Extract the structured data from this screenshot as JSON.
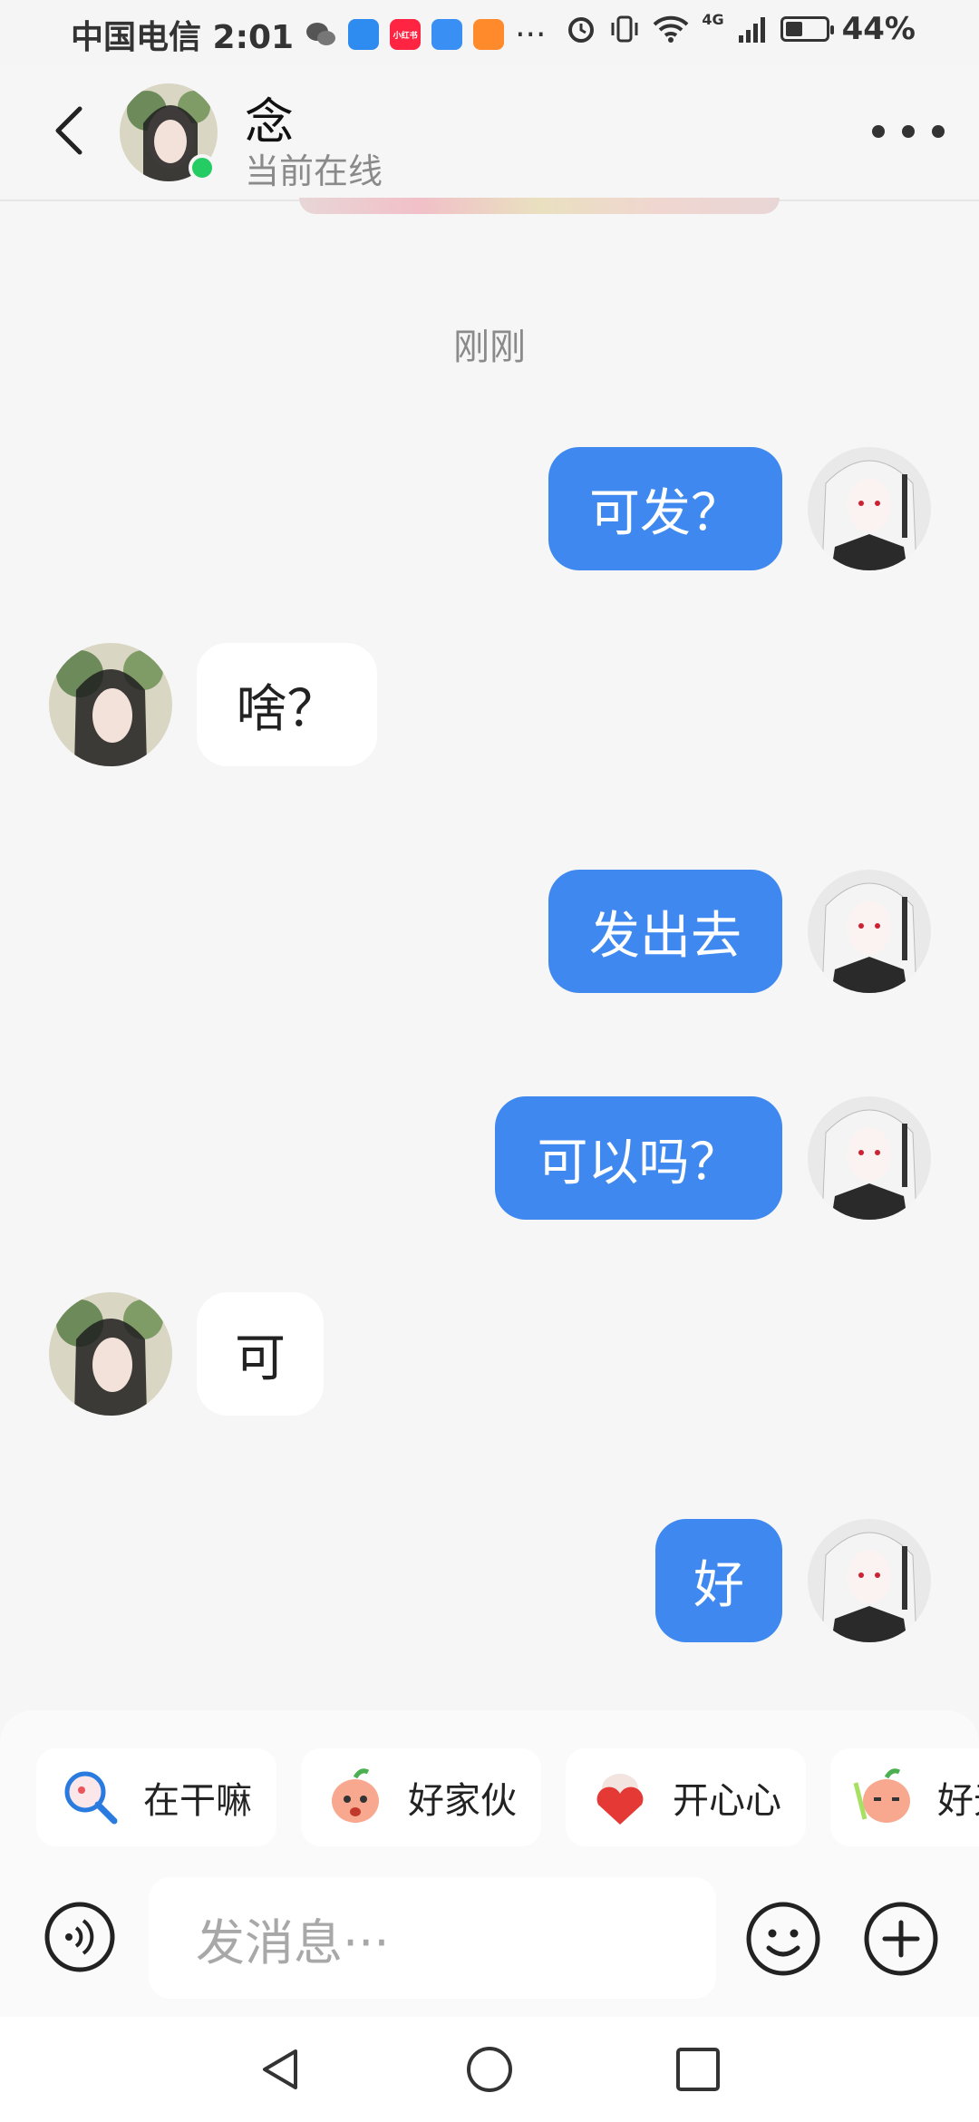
{
  "status_bar": {
    "carrier_time": "中国电信 2:01",
    "extra": "···",
    "app_badge_text": "小红书",
    "network": "4G",
    "battery": "44%",
    "battery_level": 0.44
  },
  "header": {
    "contact_name": "念",
    "status": "当前在线"
  },
  "time_divider": "刚刚",
  "messages": [
    {
      "side": "out",
      "text": "可发？"
    },
    {
      "side": "in",
      "text": "啥？"
    },
    {
      "side": "out",
      "text": "发出去"
    },
    {
      "side": "out",
      "text": "可以吗？"
    },
    {
      "side": "in",
      "text": "可"
    },
    {
      "side": "out",
      "text": "好"
    }
  ],
  "quick_stickers": [
    {
      "label": "在干嘛",
      "icon": "magnifier-sticker-icon"
    },
    {
      "label": "好家伙",
      "icon": "peach-face-sticker-icon"
    },
    {
      "label": "开心心",
      "icon": "heart-hug-sticker-icon"
    },
    {
      "label": "好无聊",
      "icon": "peach-sleepy-sticker-icon"
    }
  ],
  "input": {
    "placeholder": "发消息···"
  },
  "colors": {
    "outgoing_bubble": "#3f88ef",
    "incoming_bubble": "#ffffff",
    "online_dot": "#24cc63",
    "background": "#f6f6f6"
  }
}
